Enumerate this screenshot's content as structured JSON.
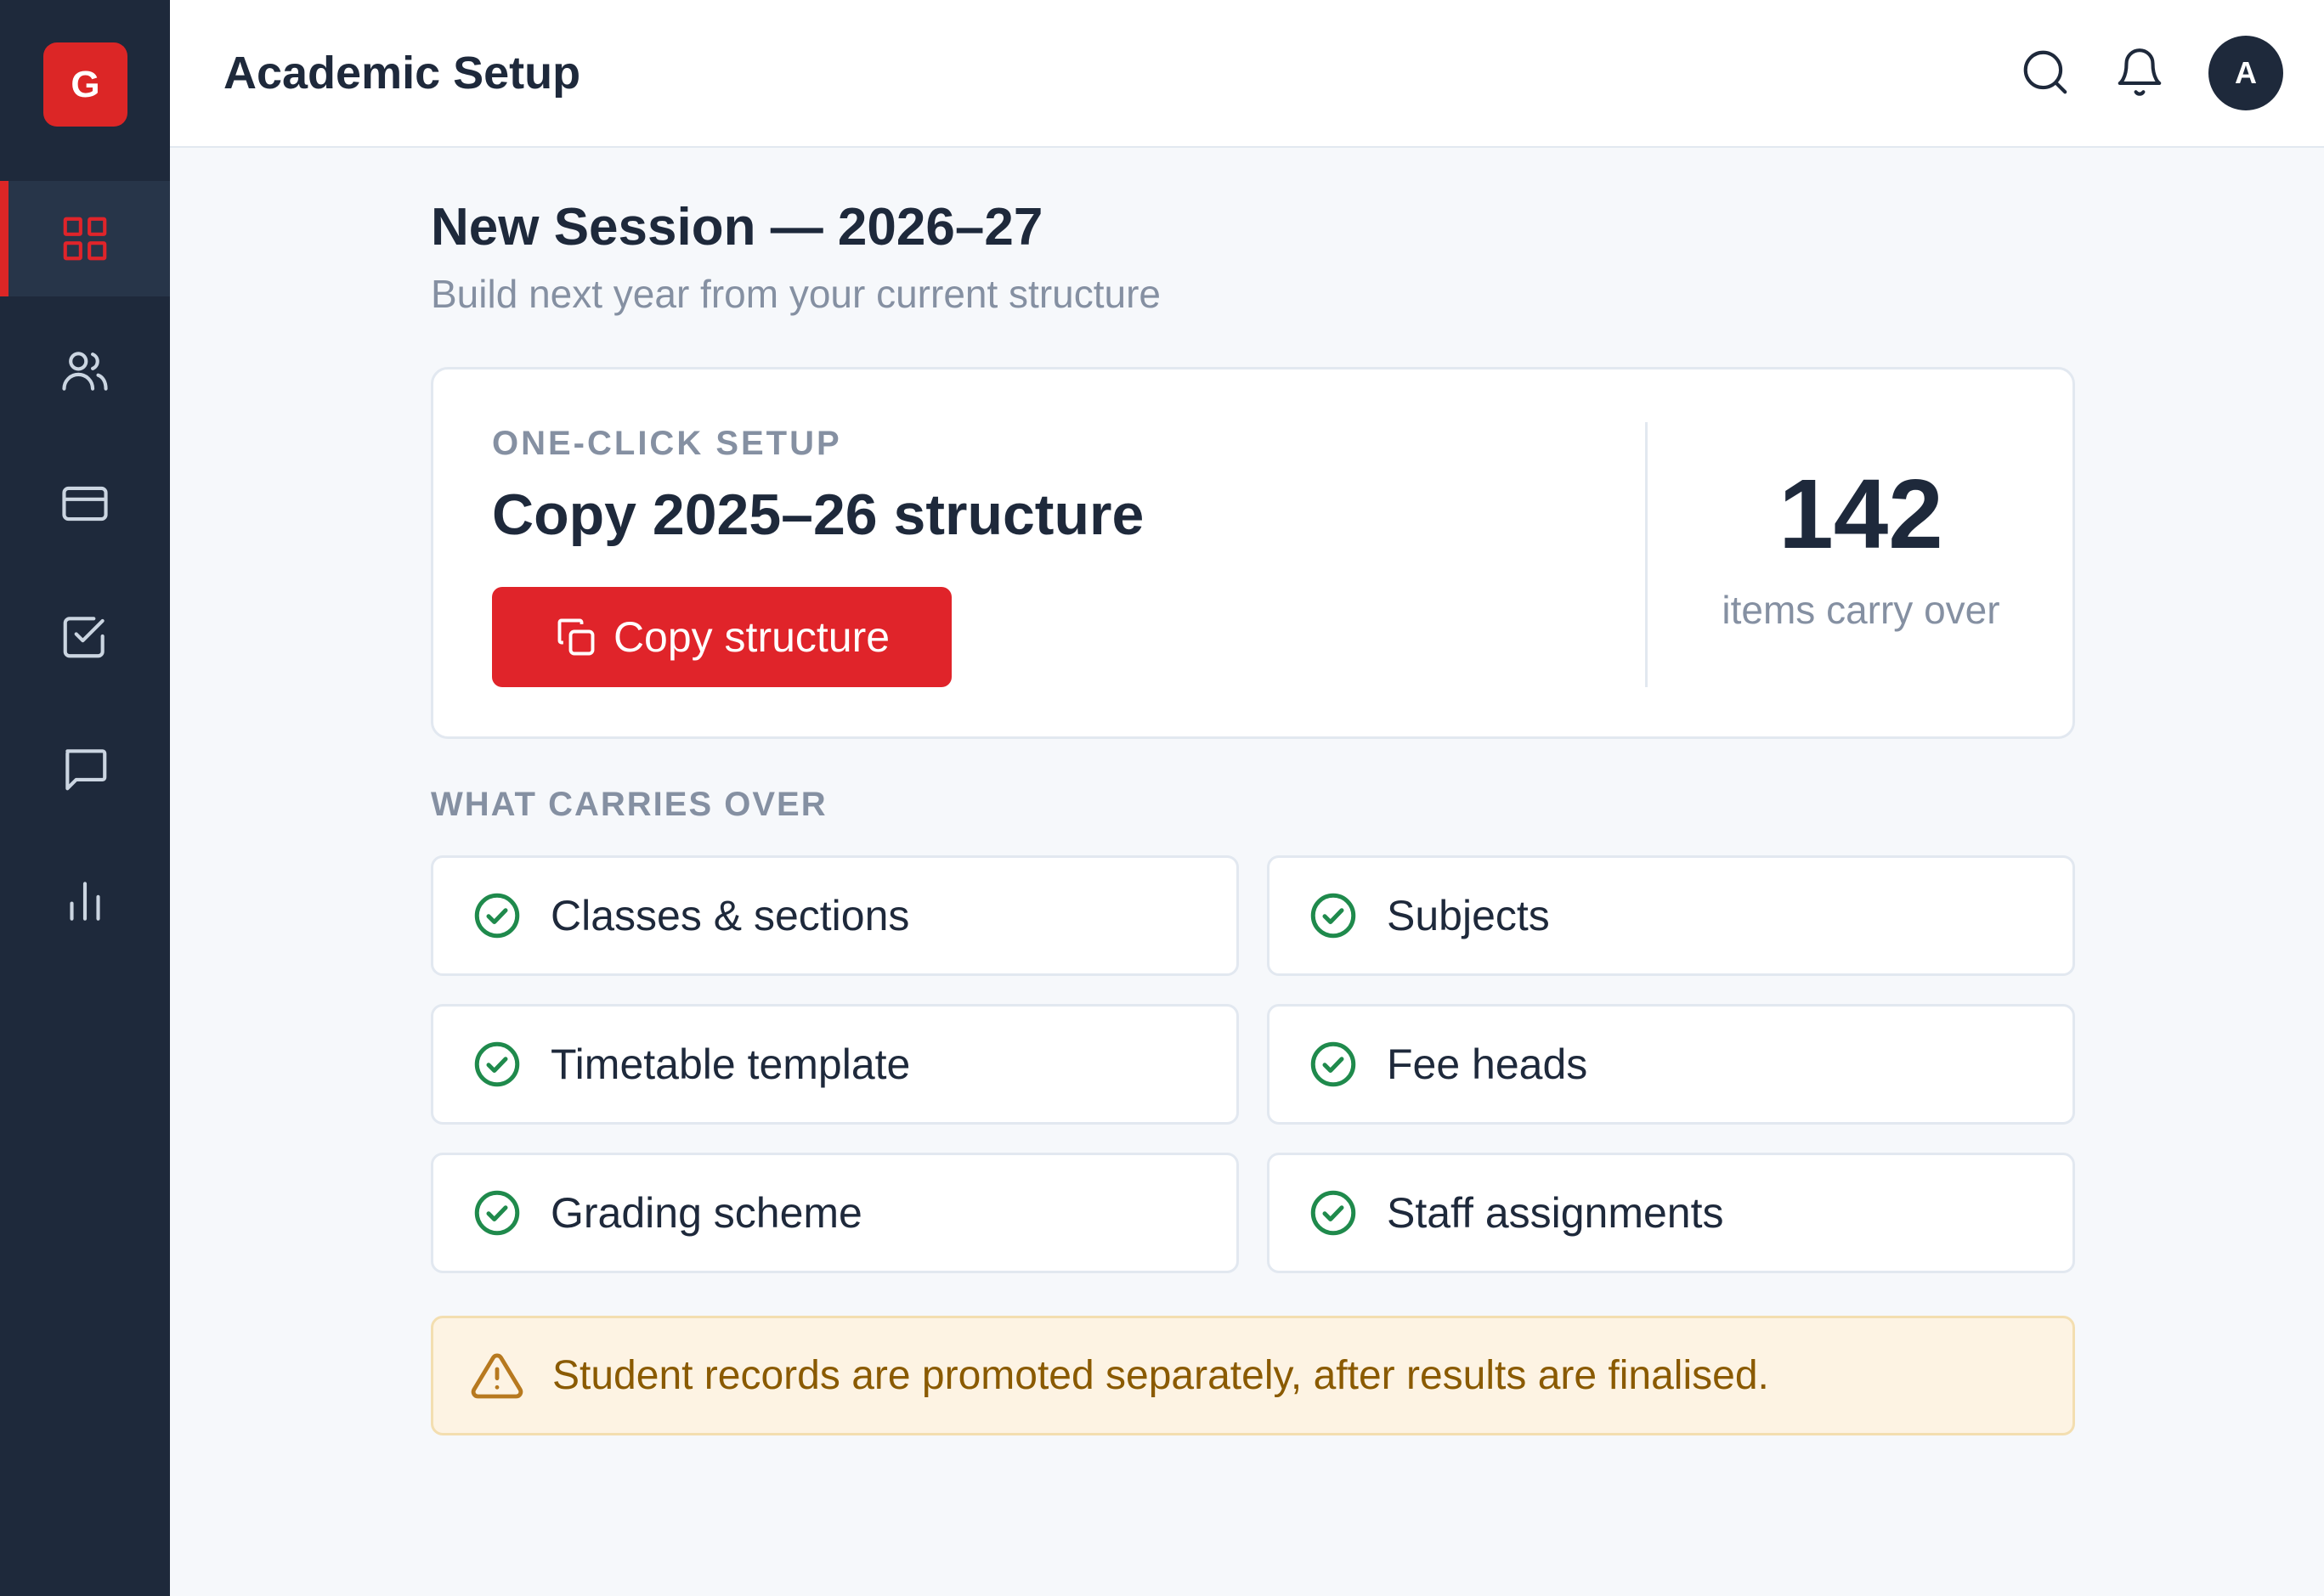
{
  "app": {
    "logo_letter": "G",
    "title": "Academic Setup"
  },
  "sidebar": {
    "items": [
      {
        "icon": "dashboard-grid-icon",
        "active": true
      },
      {
        "icon": "users-icon",
        "active": false
      },
      {
        "icon": "card-icon",
        "active": false
      },
      {
        "icon": "task-check-icon",
        "active": false
      },
      {
        "icon": "message-icon",
        "active": false
      },
      {
        "icon": "bar-chart-icon",
        "active": false
      }
    ]
  },
  "header": {
    "avatar_letter": "A",
    "icons": [
      "search-icon",
      "bell-icon"
    ]
  },
  "session": {
    "title": "New Session — 2026–27",
    "subtitle": "Build next year from your current structure"
  },
  "setup_card": {
    "eyebrow": "ONE-CLICK SETUP",
    "title": "Copy 2025–26 structure",
    "button_label": "Copy structure",
    "stat_value": "142",
    "stat_label": "items carry over"
  },
  "carries_over": {
    "label": "WHAT CARRIES OVER",
    "items": [
      "Classes & sections",
      "Subjects",
      "Timetable template",
      "Fee heads",
      "Grading scheme",
      "Staff assignments"
    ]
  },
  "notice": {
    "text": "Student records are promoted separately, after results are finalised."
  },
  "colors": {
    "sidebar": "#1e293b",
    "accent": "#dc2626",
    "success": "#1f8a4c",
    "warning_bg": "#fdf3e3",
    "warning_text": "#8a5a00"
  }
}
